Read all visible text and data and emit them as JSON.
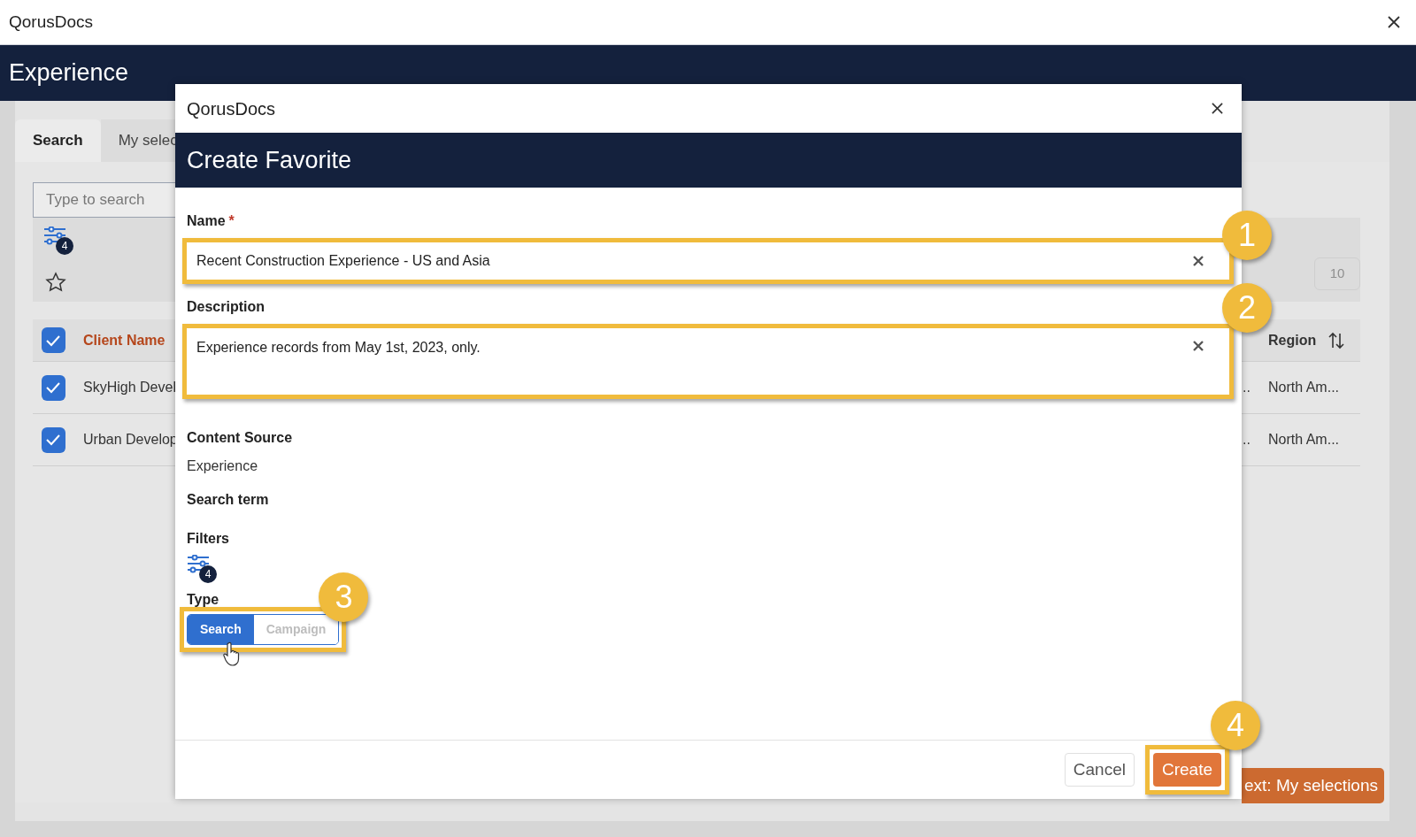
{
  "window": {
    "title": "QorusDocs"
  },
  "app_header": {
    "title": "Experience"
  },
  "tabs": [
    {
      "label": "Search",
      "selected": true
    },
    {
      "label": "My selec",
      "selected": false
    }
  ],
  "search": {
    "placeholder": "Type to search"
  },
  "filter_badge": "4",
  "page_size": "10",
  "table": {
    "header_checked": true,
    "columns": [
      "Client Name",
      "Region"
    ],
    "rows": [
      {
        "checked": true,
        "client_name": "SkyHigh Devel",
        "column_3": "..",
        "region": "North Am..."
      },
      {
        "checked": true,
        "client_name": "Urban Develop",
        "column_3": "..",
        "region": "North Am..."
      }
    ]
  },
  "next_button": "ext: My selections",
  "dialog": {
    "app_title": "QorusDocs",
    "title": "Create Favorite",
    "fields": [
      {
        "kind": "input",
        "label": "Name",
        "required_marker": "*",
        "value": "Recent Construction Experience - US and Asia",
        "callout": "1"
      },
      {
        "kind": "textarea",
        "label": "Description",
        "value": "Experience records from May 1st, 2023, only.",
        "callout": "2"
      }
    ],
    "content_source": {
      "label": "Content Source",
      "value": "Experience"
    },
    "search_term": {
      "label": "Search term"
    },
    "filters": {
      "label": "Filters",
      "badge": "4"
    },
    "type": {
      "label": "Type",
      "callout": "3",
      "options": [
        {
          "label": "Search",
          "selected": true
        },
        {
          "label": "Campaign",
          "selected": false
        }
      ]
    },
    "buttons": [
      {
        "kind": "secondary",
        "label": "Cancel"
      },
      {
        "kind": "primary",
        "label": "Create",
        "callout": "4"
      }
    ]
  }
}
